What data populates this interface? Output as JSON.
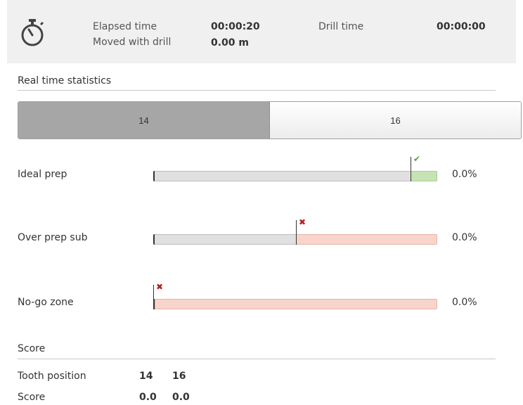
{
  "header": {
    "elapsed_label": "Elapsed time",
    "elapsed_value": "00:00:20",
    "moved_label": "Moved with drill",
    "moved_value": "0.00 m",
    "drill_label": "Drill time",
    "drill_value": "00:00:00",
    "icon": "stopwatch-icon"
  },
  "realtime": {
    "title": "Real time statistics",
    "tabs": [
      {
        "label": "14",
        "active": true
      },
      {
        "label": "16",
        "active": false
      }
    ],
    "bars": [
      {
        "label": "Ideal prep",
        "percent": "0.0%",
        "threshold_fraction": 0.905,
        "status": "ok",
        "status_icon": "check-icon"
      },
      {
        "label": "Over prep sub",
        "percent": "0.0%",
        "threshold_fraction": 0.5,
        "status": "bad",
        "status_icon": "x-icon"
      },
      {
        "label": "No-go zone",
        "percent": "0.0%",
        "threshold_fraction": 0.0,
        "status": "bad",
        "status_icon": "x-icon"
      }
    ]
  },
  "score": {
    "title": "Score",
    "tooth_label": "Tooth position",
    "tooth_values": [
      "14",
      "16"
    ],
    "score_label": "Score",
    "score_values": [
      "0.0",
      "0.0"
    ]
  },
  "colors": {
    "ok": "#5a9e2f",
    "bad": "#b32020",
    "active_tab": "#a6a6a6"
  }
}
